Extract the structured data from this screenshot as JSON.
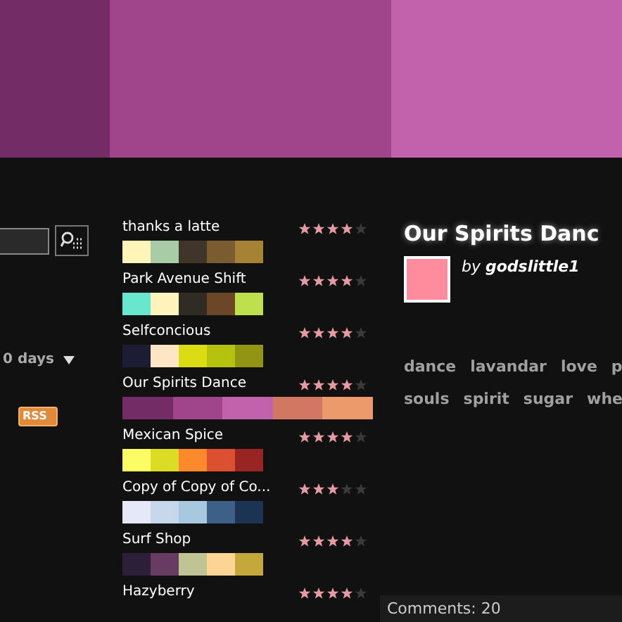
{
  "banner": {
    "colors": [
      {
        "color": "#742c66"
      },
      {
        "color": "#a0448c"
      },
      {
        "color": "#c262ac"
      }
    ]
  },
  "sidebar": {
    "period": "0 days",
    "rss": "RSS"
  },
  "palettes": [
    {
      "title": "thanks a latte",
      "stars": 4,
      "selected": false,
      "colors": [
        {
          "color": "#fff5b8"
        },
        {
          "color": "#a8cca6"
        },
        {
          "color": "#3f3529"
        },
        {
          "color": "#7a5c30"
        },
        {
          "color": "#a58234"
        }
      ]
    },
    {
      "title": "Park Avenue Shift",
      "stars": 4,
      "selected": false,
      "colors": [
        {
          "color": "#68e6ce"
        },
        {
          "color": "#fff3bc"
        },
        {
          "color": "#2f2c23"
        },
        {
          "color": "#6c4626"
        },
        {
          "color": "#bde04c"
        }
      ]
    },
    {
      "title": "Selfconcious",
      "stars": 4,
      "selected": false,
      "colors": [
        {
          "color": "#1c1c34"
        },
        {
          "color": "#fee6c4"
        },
        {
          "color": "#dcdc14"
        },
        {
          "color": "#b5c20e"
        },
        {
          "color": "#919512"
        }
      ]
    },
    {
      "title": "Our Spirits Dance",
      "stars": 4,
      "selected": true,
      "colors": [
        {
          "color": "#742c66"
        },
        {
          "color": "#a0448c"
        },
        {
          "color": "#c262ac"
        },
        {
          "color": "#d27862"
        },
        {
          "color": "#ec9a6c"
        }
      ]
    },
    {
      "title": "Mexican Spice",
      "stars": 4,
      "selected": false,
      "colors": [
        {
          "color": "#fcfc64"
        },
        {
          "color": "#dcdc24"
        },
        {
          "color": "#fc8a2c"
        },
        {
          "color": "#dc5030"
        },
        {
          "color": "#982424"
        }
      ]
    },
    {
      "title": "Copy of Copy of Co...",
      "stars": 3,
      "selected": false,
      "colors": [
        {
          "color": "#e4e8f8"
        },
        {
          "color": "#c8d8ec"
        },
        {
          "color": "#a8c8e0"
        },
        {
          "color": "#3c6088"
        },
        {
          "color": "#1c3454"
        }
      ]
    },
    {
      "title": "Surf Shop",
      "stars": 4,
      "selected": false,
      "colors": [
        {
          "color": "#2c2038"
        },
        {
          "color": "#683c62"
        },
        {
          "color": "#c0c494"
        },
        {
          "color": "#fcd494"
        },
        {
          "color": "#c4a83c"
        }
      ]
    },
    {
      "title": "Hazyberry",
      "stars": 4
    }
  ],
  "detail": {
    "title": "Our Spirits Danc",
    "color": "#ff8c9c",
    "author_prefix": "by",
    "author": "godslittle1",
    "tags": [
      "dance",
      "lavandar",
      "love",
      "p",
      "souls",
      "spirit",
      "sugar",
      "whe"
    ],
    "comments": "Comments: 20"
  }
}
